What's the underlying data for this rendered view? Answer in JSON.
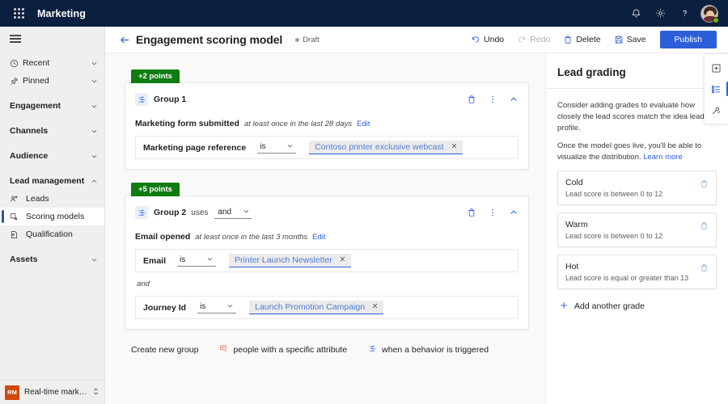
{
  "topbar": {
    "waffle_label": "app-launcher",
    "brand": "Marketing",
    "notifications_label": "Notifications",
    "settings_label": "Settings",
    "help_label": "Help",
    "avatar_label": "Account manager"
  },
  "sidebar": {
    "menu_label": "Show / hide navigation",
    "items": [
      {
        "label": "Recent",
        "icon": "clock-icon",
        "type": "link",
        "chevron": "down"
      },
      {
        "label": "Pinned",
        "icon": "pin-icon",
        "type": "link",
        "chevron": "down"
      },
      {
        "label": "Engagement",
        "icon": "",
        "type": "group",
        "chevron": "down"
      },
      {
        "label": "Channels",
        "icon": "",
        "type": "group",
        "chevron": "down"
      },
      {
        "label": "Audience",
        "icon": "",
        "type": "group",
        "chevron": "down"
      },
      {
        "label": "Lead management",
        "icon": "",
        "type": "group",
        "chevron": "up"
      },
      {
        "label": "Leads",
        "icon": "leads-icon",
        "type": "sub",
        "chevron": ""
      },
      {
        "label": "Scoring models",
        "icon": "scoring-models-icon",
        "type": "sub-selected",
        "chevron": ""
      },
      {
        "label": "Qualification",
        "icon": "qualification-icon",
        "type": "sub",
        "chevron": ""
      },
      {
        "label": "Assets",
        "icon": "",
        "type": "group",
        "chevron": "down"
      }
    ],
    "footer": {
      "initials": "RM",
      "app_name": "Real-time marketi…"
    }
  },
  "command_bar": {
    "back_label": "Back",
    "title": "Engagement scoring model",
    "status": "Draft",
    "actions": [
      {
        "label": "Undo",
        "icon": "undo-icon",
        "disabled": false
      },
      {
        "label": "Redo",
        "icon": "redo-icon",
        "disabled": true
      },
      {
        "label": "Delete",
        "icon": "delete-icon",
        "disabled": false
      },
      {
        "label": "Save",
        "icon": "save-icon",
        "disabled": false
      }
    ],
    "publish_label": "Publish"
  },
  "builder": {
    "groups": [
      {
        "points_badge": "+2 points",
        "name": "Group 1",
        "uses_label": "",
        "logic_operator": "",
        "trigger_name": "Marketing form submitted",
        "trigger_frequency": "at least once in the last 28 days",
        "edit_label": "Edit",
        "conditions": [
          {
            "attribute": "Marketing page reference",
            "operator": "is",
            "value": "Contoso printer exclusive webcast",
            "remove_label": "✕"
          }
        ],
        "separators": []
      },
      {
        "points_badge": "+5 points",
        "name": "Group 2",
        "uses_label": "uses",
        "logic_operator": "and",
        "trigger_name": "Email opened",
        "trigger_frequency": "at least once in the last 3 months",
        "edit_label": "Edit",
        "conditions": [
          {
            "attribute": "Email",
            "operator": "is",
            "value": "Printer Launch Newsletter",
            "remove_label": "✕"
          },
          {
            "attribute": "Journey Id",
            "operator": "is",
            "value": "Launch Promotion Campaign",
            "remove_label": "✕"
          }
        ],
        "separators": [
          "and"
        ]
      }
    ],
    "create_row": {
      "label": "Create new group",
      "options": [
        {
          "label": "people with a specific attribute",
          "icon": "attribute-icon"
        },
        {
          "label": "when a behavior is triggered",
          "icon": "behavior-icon"
        }
      ]
    },
    "group_actions": {
      "delete_label": "Delete group",
      "more_label": "More commands",
      "collapse_label": "Collapse"
    }
  },
  "right_panel": {
    "title": "Lead grading",
    "collapse_label": "Collapse pane",
    "description_1": "Consider adding grades to evaluate how closely the lead scores match the idea lead profile.",
    "description_2": "Once the model goes live, you'll be able to visualize the distribution.",
    "learn_more": "Learn more",
    "grades": [
      {
        "name": "Cold",
        "description": "Lead score is between 0 to 12",
        "delete_label": "Delete grade"
      },
      {
        "name": "Warm",
        "description": "Lead score is between 0 to 12",
        "delete_label": "Delete grade"
      },
      {
        "name": "Hot",
        "description": "Lead score is equal or greater than 13",
        "delete_label": "Delete grade"
      }
    ],
    "add_grade_label": "Add another grade"
  },
  "rail": {
    "buttons": [
      {
        "name": "model-properties-icon",
        "label": "Model properties",
        "active": false
      },
      {
        "name": "lead-grading-icon",
        "label": "Lead grading",
        "active": true
      },
      {
        "name": "advanced-settings-icon",
        "label": "Advanced settings",
        "active": false
      }
    ]
  },
  "colors": {
    "brand_navy": "#0b1f3f",
    "accent_blue": "#2b5fd9",
    "points_green": "#107c10",
    "chip_blue_text": "#4e7fd4",
    "app_tile_orange": "#d1480b",
    "presence_green": "#6bb700"
  }
}
